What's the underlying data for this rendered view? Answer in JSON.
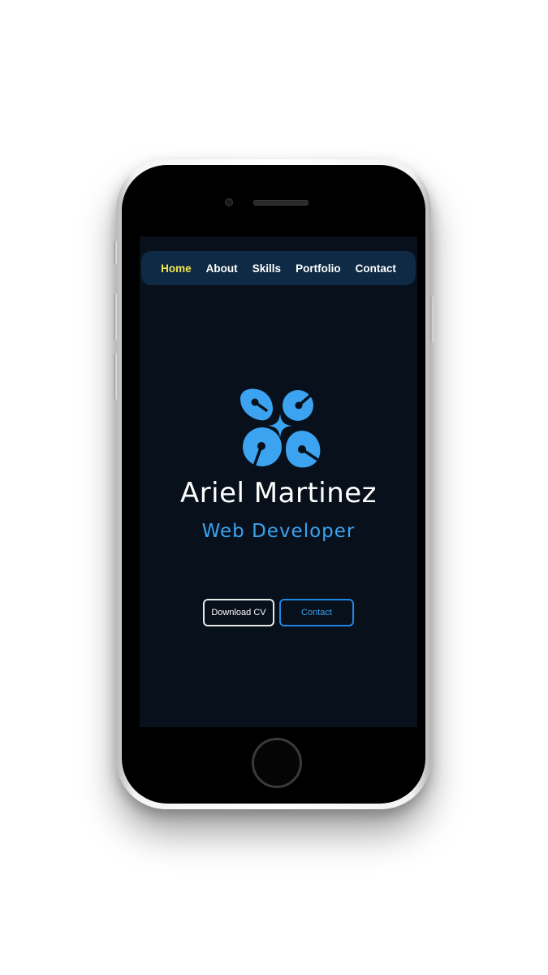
{
  "nav": {
    "items": [
      {
        "label": "Home",
        "active": true
      },
      {
        "label": "About",
        "active": false
      },
      {
        "label": "Skills",
        "active": false
      },
      {
        "label": "Portfolio",
        "active": false
      },
      {
        "label": "Contact",
        "active": false
      }
    ]
  },
  "hero": {
    "logo_icon": "four-petal-circuit-logo-icon",
    "name": "Ariel Martinez",
    "role": "Web Developer",
    "buttons": {
      "download_cv": "Download CV",
      "contact": "Contact"
    }
  },
  "colors": {
    "screen_bg": "#07101b",
    "nav_bg": "#0f2a44",
    "nav_active": "#f1e84a",
    "accent": "#3ba3f0"
  }
}
